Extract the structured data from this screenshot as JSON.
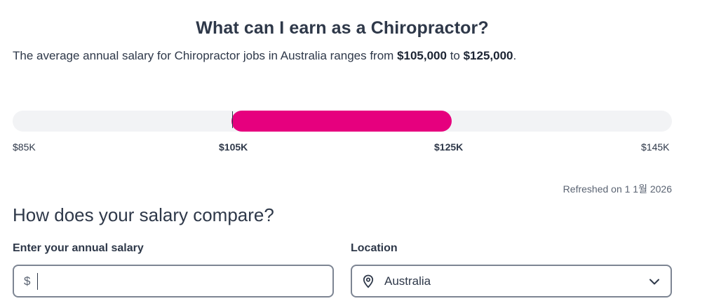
{
  "header": {
    "title": "What can I earn as a Chiropractor?",
    "summary_prefix": "The average annual salary for Chiropractor jobs in Australia ranges from ",
    "summary_low": "$105,000",
    "summary_mid": " to ",
    "summary_high": "$125,000",
    "summary_suffix": "."
  },
  "salary_range": {
    "scale_min": 85000,
    "scale_max": 145000,
    "range_low": 105000,
    "range_high": 125000,
    "bar_color": "#e6007e",
    "ticks": [
      "$85K",
      "$105K",
      "$125K",
      "$145K"
    ]
  },
  "refreshed": "Refreshed on 1 1월 2026",
  "compare": {
    "title": "How does your salary compare?",
    "salary_label": "Enter your annual salary",
    "currency_symbol": "$",
    "salary_value": "",
    "location_label": "Location",
    "location_value": "Australia",
    "location_icon": "map-pin-icon",
    "dropdown_icon": "chevron-down-icon"
  }
}
